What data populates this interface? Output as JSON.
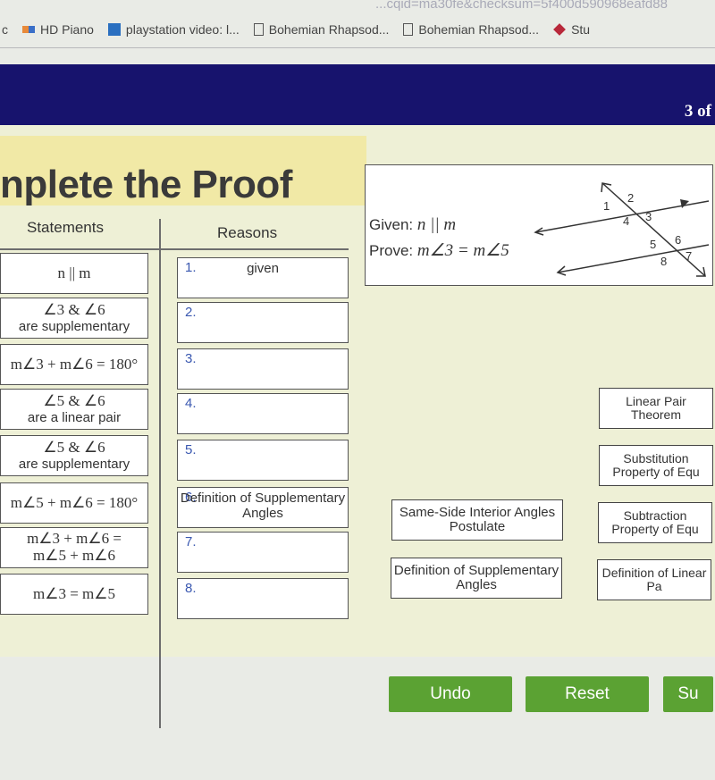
{
  "browser": {
    "url_fragment": "...cqid=ma30fe&checksum=5f400d590968eafd88",
    "bookmarks": [
      {
        "label": "c",
        "icon": "none"
      },
      {
        "label": "HD Piano",
        "icon": "piano-icon"
      },
      {
        "label": "playstation video: l...",
        "icon": "playstation-icon"
      },
      {
        "label": "Bohemian Rhapsod...",
        "icon": "document-icon"
      },
      {
        "label": "Bohemian Rhapsod...",
        "icon": "document-icon"
      },
      {
        "label": "Stu",
        "icon": "diamond-logo-icon"
      }
    ]
  },
  "header": {
    "progress": "3 of"
  },
  "proof": {
    "title": "nplete the Proof",
    "statements_header": "Statements",
    "reasons_header": "Reasons",
    "statements": [
      {
        "line1": "n || m",
        "line2": ""
      },
      {
        "line1": "∠3 & ∠6",
        "line2": "are supplementary"
      },
      {
        "line1": "m∠3 + m∠6 = 180°",
        "line2": ""
      },
      {
        "line1": "∠5 & ∠6",
        "line2": "are a linear pair"
      },
      {
        "line1": "∠5 & ∠6",
        "line2": "are supplementary"
      },
      {
        "line1": "m∠5 + m∠6 = 180°",
        "line2": ""
      },
      {
        "line1": "m∠3 + m∠6 =",
        "line2": "m∠5 + m∠6"
      },
      {
        "line1": "m∠3 = m∠5",
        "line2": ""
      }
    ],
    "reasons": [
      {
        "num": "1.",
        "text": "given"
      },
      {
        "num": "2.",
        "text": ""
      },
      {
        "num": "3.",
        "text": ""
      },
      {
        "num": "4.",
        "text": ""
      },
      {
        "num": "5.",
        "text": ""
      },
      {
        "num": "6.",
        "text": "Definition of Supplementary Angles"
      },
      {
        "num": "7.",
        "text": ""
      },
      {
        "num": "8.",
        "text": ""
      }
    ]
  },
  "given_box": {
    "given_label": "Given:",
    "given_value": "n || m",
    "prove_label": "Prove:",
    "prove_value": "m∠3 = m∠5",
    "angle_labels": [
      "1",
      "2",
      "3",
      "4",
      "5",
      "6",
      "7",
      "8"
    ]
  },
  "options": [
    "Linear Pair Theorem",
    "Substitution Property of Equ",
    "Same-Side Interior Angles Postulate",
    "Subtraction Property of Equ",
    "Definition of Supplementary Angles",
    "Definition of Linear Pa"
  ],
  "buttons": {
    "undo": "Undo",
    "reset": "Reset",
    "submit": "Su"
  },
  "colors": {
    "navy": "#17136d",
    "button_green": "#5ba233",
    "content_bg": "#eef0d6"
  }
}
